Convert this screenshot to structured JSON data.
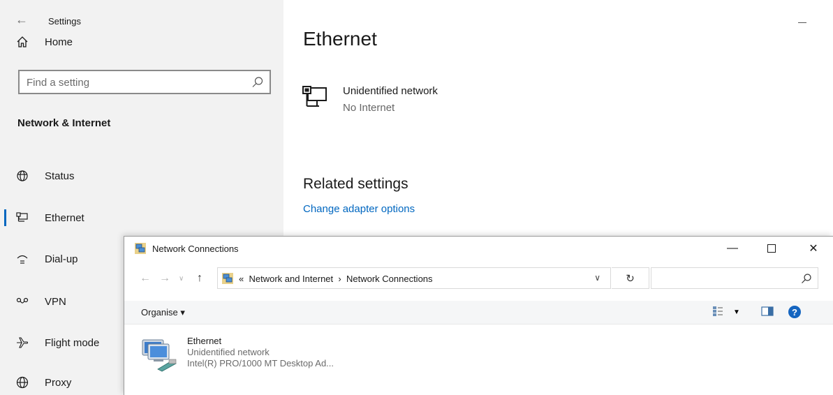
{
  "settings": {
    "app_title": "Settings",
    "home_label": "Home",
    "search_placeholder": "Find a setting",
    "section_title": "Network & Internet",
    "nav": [
      {
        "label": "Status",
        "icon": "globe-status-icon"
      },
      {
        "label": "Ethernet",
        "icon": "ethernet-icon",
        "active": true
      },
      {
        "label": "Dial-up",
        "icon": "dial-up-icon"
      },
      {
        "label": "VPN",
        "icon": "vpn-icon"
      },
      {
        "label": "Flight mode",
        "icon": "airplane-icon"
      },
      {
        "label": "Proxy",
        "icon": "globe-icon"
      }
    ],
    "page_title": "Ethernet",
    "network_name": "Unidentified network",
    "network_status": "No Internet",
    "related_title": "Related settings",
    "related_link": "Change adapter options"
  },
  "explorer": {
    "title": "Network Connections",
    "breadcrumb_prefix": "«",
    "breadcrumb": [
      "Network and Internet",
      "Network Connections"
    ],
    "breadcrumb_separator": "›",
    "organise_label": "Organise ▾",
    "items": [
      {
        "name": "Ethernet",
        "status": "Unidentified network",
        "device": "Intel(R) PRO/1000 MT Desktop Ad..."
      }
    ]
  },
  "colors": {
    "accent": "#0067c0",
    "sidebar_bg": "#f2f2f2"
  }
}
